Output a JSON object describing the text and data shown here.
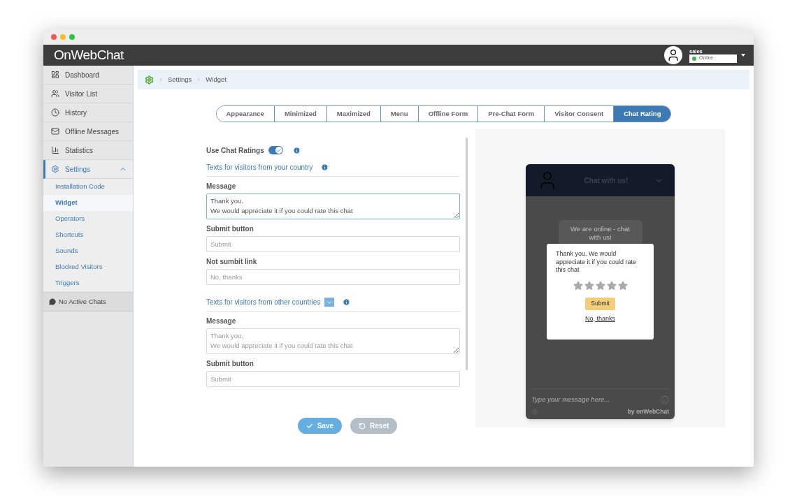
{
  "header": {
    "logo": "OnWebChat",
    "user": {
      "name": "sales",
      "status": "Online"
    }
  },
  "sidebar": {
    "items": [
      {
        "label": "Dashboard",
        "kind": "dashboard",
        "selected": false
      },
      {
        "label": "Visitor List",
        "kind": "users",
        "selected": false
      },
      {
        "label": "History",
        "kind": "clock",
        "selected": false
      },
      {
        "label": "Offline Messages",
        "kind": "mail",
        "selected": false
      },
      {
        "label": "Statistics",
        "kind": "chart",
        "selected": false
      },
      {
        "label": "Settings",
        "kind": "gear",
        "selected": true,
        "expanded": true,
        "children": [
          {
            "label": "Installation Code",
            "selected": false
          },
          {
            "label": "Widget",
            "selected": true
          },
          {
            "label": "Operators",
            "selected": false
          },
          {
            "label": "Shortcuts",
            "selected": false
          },
          {
            "label": "Sounds",
            "selected": false
          },
          {
            "label": "Blocked Visitors",
            "selected": false
          },
          {
            "label": "Triggers",
            "selected": false
          }
        ]
      }
    ],
    "footer": "No Active Chats"
  },
  "breadcrumb": [
    "Settings",
    "Widget"
  ],
  "tabs": [
    {
      "label": "Appearance",
      "selected": false
    },
    {
      "label": "Minimized",
      "selected": false
    },
    {
      "label": "Maximized",
      "selected": false
    },
    {
      "label": "Menu",
      "selected": false
    },
    {
      "label": "Offline Form",
      "selected": false
    },
    {
      "label": "Pre-Chat Form",
      "selected": false
    },
    {
      "label": "Visitor Consent",
      "selected": false
    },
    {
      "label": "Chat Rating",
      "selected": true
    }
  ],
  "form": {
    "use_ratings": {
      "label": "Use Chat Ratings",
      "on": true
    },
    "sections": [
      {
        "title": "Texts for visitors from your country",
        "collapsible": false,
        "fields": [
          {
            "label": "Message",
            "kind": "textarea",
            "value": "Thank you.\nWe would appreciate it if you could rate this chat",
            "focused": true
          },
          {
            "label": "Submit button",
            "kind": "input",
            "placeholder": "Submit"
          },
          {
            "label": "Not sumbit link",
            "kind": "input",
            "placeholder": "No, thanks"
          }
        ]
      },
      {
        "title": "Texts for visitors from other countries",
        "collapsible": true,
        "fields": [
          {
            "label": "Message",
            "kind": "textarea",
            "placeholder": "Thank you.\nWe would appreciate it if you could rate this chat",
            "focused": false
          },
          {
            "label": "Submit button",
            "kind": "input",
            "placeholder": "Submit"
          }
        ]
      }
    ],
    "buttons": [
      {
        "label": "Save",
        "kind": "save"
      },
      {
        "label": "Reset",
        "kind": "reset"
      }
    ]
  },
  "preview": {
    "title": "Chat with us!",
    "bubble": "We are online - chat with us!",
    "rating": {
      "message": "Thank you. We would appreciate it if you could rate this chat",
      "stars": 0,
      "submit": "Submit",
      "decline": "No, thanks"
    },
    "input_placeholder": "Type your message here...",
    "brand": "by onWebChat"
  }
}
